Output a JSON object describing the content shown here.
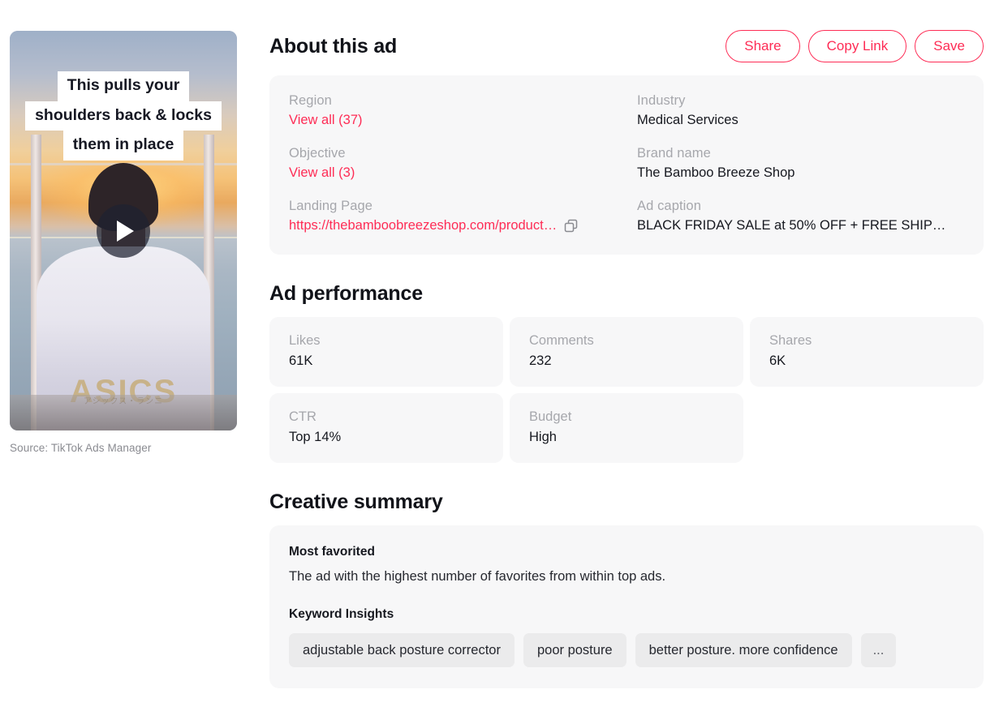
{
  "colors": {
    "accent": "#fe2c55",
    "card_bg": "#f7f7f8",
    "chip_bg": "#ebebec",
    "text_primary": "#16181f",
    "text_muted": "#a6a7ac"
  },
  "video": {
    "caption_lines": [
      "This pulls your",
      "shoulders back & locks",
      "them in place"
    ],
    "shirt_logo": "ASICS",
    "shirt_sub": "アシックス・ランニ",
    "play_icon": "play-icon",
    "source": "Source: TikTok Ads Manager"
  },
  "header": {
    "title": "About this ad",
    "buttons": [
      {
        "label": "Share",
        "name": "share-button"
      },
      {
        "label": "Copy Link",
        "name": "copy-link-button"
      },
      {
        "label": "Save",
        "name": "save-button"
      }
    ]
  },
  "about": {
    "fields": [
      {
        "label": "Region",
        "value": "View all (37)",
        "is_link": true
      },
      {
        "label": "Industry",
        "value": "Medical Services",
        "is_link": false
      },
      {
        "label": "Objective",
        "value": "View all (3)",
        "is_link": true
      },
      {
        "label": "Brand name",
        "value": "The Bamboo Breeze Shop",
        "is_link": false
      },
      {
        "label": "Landing Page",
        "value": "https://thebamboobreezeshop.com/product…",
        "is_link": true,
        "copy_icon": "copy-icon"
      },
      {
        "label": "Ad caption",
        "value": "BLACK FRIDAY SALE at 50% OFF + FREE SHIP…",
        "is_link": false
      }
    ]
  },
  "performance": {
    "title": "Ad performance",
    "metrics": [
      {
        "label": "Likes",
        "value": "61K"
      },
      {
        "label": "Comments",
        "value": "232"
      },
      {
        "label": "Shares",
        "value": "6K"
      },
      {
        "label": "CTR",
        "value": "Top 14%"
      },
      {
        "label": "Budget",
        "value": "High"
      }
    ]
  },
  "creative": {
    "title": "Creative summary",
    "most_favorited_label": "Most favorited",
    "most_favorited_text": "The ad with the highest number of favorites from within top ads.",
    "keyword_label": "Keyword Insights",
    "keywords": [
      "adjustable back posture corrector",
      "poor posture",
      "better posture. more confidence"
    ],
    "keywords_more": "..."
  }
}
